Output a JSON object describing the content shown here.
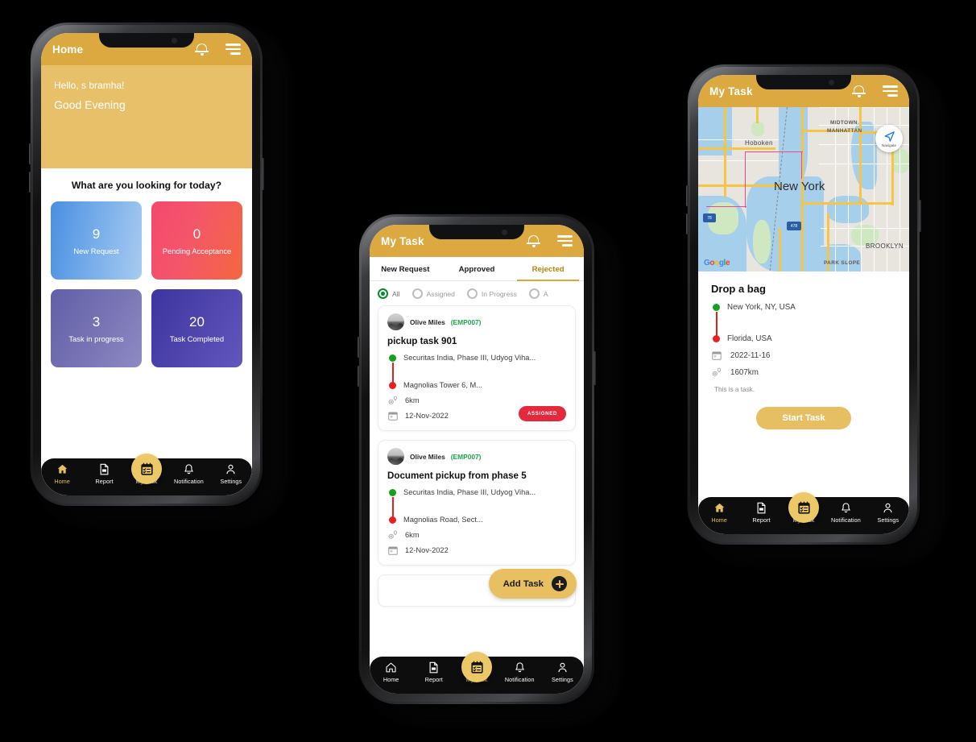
{
  "accent": {
    "gold": "#dba93f",
    "gold_light": "#e9c06a",
    "green": "#17a01f",
    "red": "#e62020",
    "badge_red": "#e5293c"
  },
  "phone1": {
    "appbar": {
      "title": "Home",
      "bell": "bell-icon",
      "menu": "hamburger-menu-icon"
    },
    "greeting": {
      "line1": "Hello, s bramha!",
      "line2": "Good Evening"
    },
    "sheet_title": "What are you looking for today?",
    "cards": [
      {
        "num": "9",
        "label": "New Request"
      },
      {
        "num": "0",
        "label": "Pending Acceptance"
      },
      {
        "num": "3",
        "label": "Task in progress"
      },
      {
        "num": "20",
        "label": "Task Completed"
      }
    ],
    "nav": {
      "active": "Home",
      "items": [
        "Home",
        "Report",
        "My Task",
        "Notification",
        "Settings"
      ]
    }
  },
  "phone2": {
    "appbar": {
      "title": "My Task"
    },
    "tabs": [
      {
        "label": "New Request",
        "active": false
      },
      {
        "label": "Approved",
        "active": false
      },
      {
        "label": "Rejected",
        "active": true
      }
    ],
    "filters": [
      {
        "label": "All",
        "selected": true
      },
      {
        "label": "Assigned",
        "selected": false
      },
      {
        "label": "In Progress",
        "selected": false
      },
      {
        "label": "A",
        "selected": false
      }
    ],
    "tasks": [
      {
        "user_name": "Olive Miles",
        "user_code": "(EMP007)",
        "title": "pickup task 901",
        "from": "Securitas India, Phase III, Udyog Viha...",
        "to": "Magnolias Tower 6, M...",
        "distance": "6km",
        "date": "12-Nov-2022",
        "status": "ASSIGNED"
      },
      {
        "user_name": "Olive Miles",
        "user_code": "(EMP007)",
        "title": "Document pickup from phase 5",
        "from": "Securitas India, Phase III, Udyog Viha...",
        "to": "Magnolias Road, Sect...",
        "distance": "6km",
        "date": "12-Nov-2022",
        "status": ""
      }
    ],
    "add_task_label": "Add Task",
    "nav": {
      "active": "My Task",
      "items": [
        "Home",
        "Report",
        "My Task",
        "Notification",
        "Settings"
      ]
    }
  },
  "phone3": {
    "appbar": {
      "title": "My Task"
    },
    "map": {
      "labels": [
        "MIDTOWN",
        "MANHATTAN",
        "Hoboken",
        "BROOKLYN",
        "PARK SLOPE"
      ],
      "city": "New York",
      "nav_button": "Navigate",
      "attribution": "Google",
      "highways": [
        "78",
        "478"
      ]
    },
    "detail": {
      "title": "Drop a bag",
      "from": "New York, NY, USA",
      "to": "Florida, USA",
      "date": "2022-11-16",
      "distance": "1607km",
      "note": "This is a task.",
      "start_label": "Start Task"
    },
    "nav": {
      "active": "Home",
      "items": [
        "Home",
        "Report",
        "My Task",
        "Notification",
        "Settings"
      ]
    }
  }
}
